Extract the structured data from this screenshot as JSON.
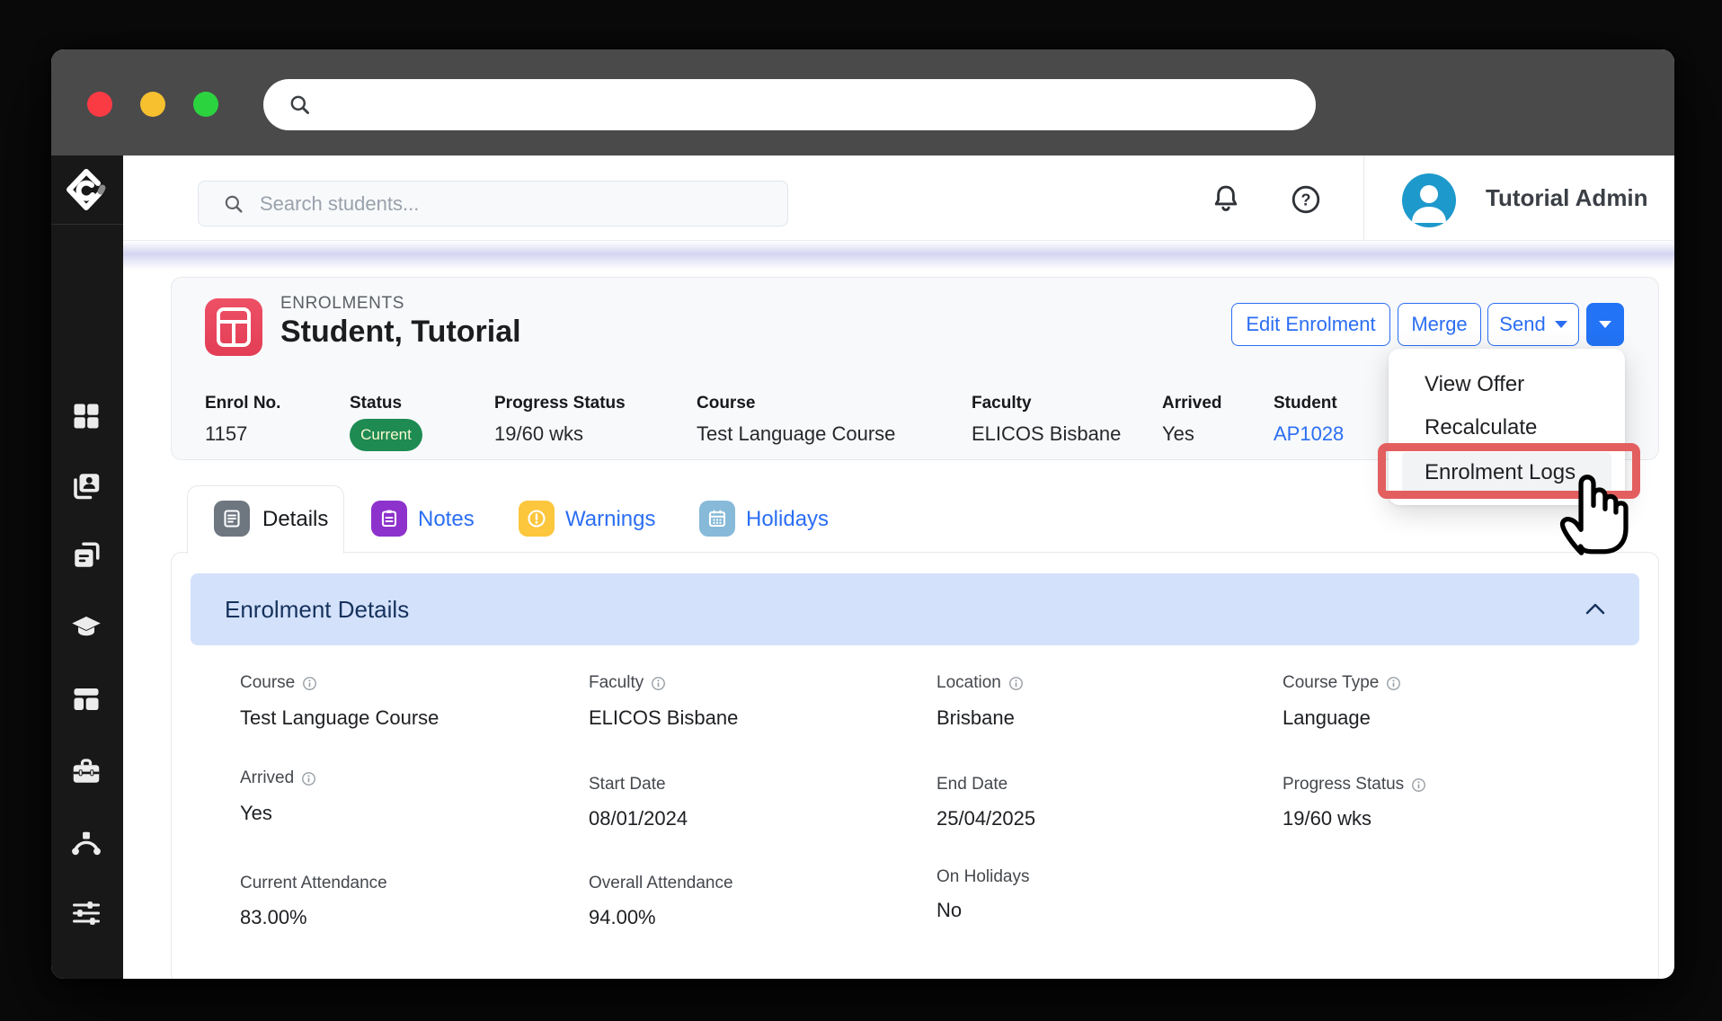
{
  "topbar": {
    "search_placeholder": "Search students...",
    "user_name": "Tutorial Admin"
  },
  "header": {
    "eyebrow": "ENROLMENTS",
    "title": "Student, Tutorial",
    "buttons": {
      "edit": "Edit Enrolment",
      "merge": "Merge",
      "send": "Send"
    }
  },
  "menu": {
    "items": [
      {
        "label": "View Offer",
        "highlighted": false
      },
      {
        "label": "Recalculate",
        "highlighted": false
      },
      {
        "label": "Enrolment Logs",
        "highlighted": true
      }
    ],
    "annotation": "red box and hand cursor on Enrolment Logs"
  },
  "summary": {
    "fields": [
      {
        "label": "Enrol No.",
        "value": "1157"
      },
      {
        "label": "Status",
        "value": "Current",
        "type": "badge"
      },
      {
        "label": "Progress Status",
        "value": "19/60 wks"
      },
      {
        "label": "Course",
        "value": "Test Language Course"
      },
      {
        "label": "Faculty",
        "value": "ELICOS Bisbane"
      },
      {
        "label": "Arrived",
        "value": "Yes"
      },
      {
        "label": "Student",
        "value": "AP1028",
        "type": "link"
      }
    ]
  },
  "tabs": [
    {
      "label": "Details",
      "active": true,
      "icon": "document-icon"
    },
    {
      "label": "Notes",
      "active": false,
      "icon": "clipboard-icon"
    },
    {
      "label": "Warnings",
      "active": false,
      "icon": "warning-icon"
    },
    {
      "label": "Holidays",
      "active": false,
      "icon": "calendar-icon"
    }
  ],
  "section": {
    "title": "Enrolment Details"
  },
  "details": {
    "rows": [
      [
        {
          "label": "Course",
          "info": true,
          "value": "Test Language Course"
        },
        {
          "label": "Faculty",
          "info": true,
          "value": "ELICOS Bisbane"
        },
        {
          "label": "Location",
          "info": true,
          "value": "Brisbane"
        },
        {
          "label": "Course Type",
          "info": true,
          "value": "Language"
        }
      ],
      [
        {
          "label": "Arrived",
          "info": true,
          "value": "Yes"
        },
        {
          "label": "Start Date",
          "info": false,
          "value": "08/01/2024"
        },
        {
          "label": "End Date",
          "info": false,
          "value": "25/04/2025"
        },
        {
          "label": "Progress Status",
          "info": true,
          "value": "19/60 wks"
        }
      ],
      [
        {
          "label": "Current Attendance",
          "info": false,
          "value": "83.00%"
        },
        {
          "label": "Overall Attendance",
          "info": false,
          "value": "94.00%"
        },
        {
          "label": "On Holidays",
          "info": false,
          "value": "No"
        }
      ]
    ]
  },
  "sidebar": {
    "icons": [
      "dashboard",
      "students",
      "documents",
      "courses",
      "enrolments",
      "toolbox",
      "workflows",
      "settings"
    ]
  },
  "colors": {
    "accent_blue": "#2b6ef3",
    "solid_blue": "#2273f5",
    "badge_green": "#1d8b52",
    "badge_text": "#fbf7d0",
    "enrolments_red": "#e9495d",
    "notes_purple": "#8d32cc",
    "warnings_yellow": "#fcc63d",
    "holidays_blue": "#87bad9",
    "details_gray": "#6e7680",
    "section_bg": "#d3e1fb",
    "section_text": "#16325c",
    "annotation_red": "#e35f5f",
    "avatar_blue": "#1d99cc",
    "titlebar": "#4a4a4b",
    "sidebar_bg": "#181818",
    "traffic_red": "#fa3b44",
    "traffic_yellow": "#f6c02e",
    "traffic_green": "#2bd43f"
  }
}
